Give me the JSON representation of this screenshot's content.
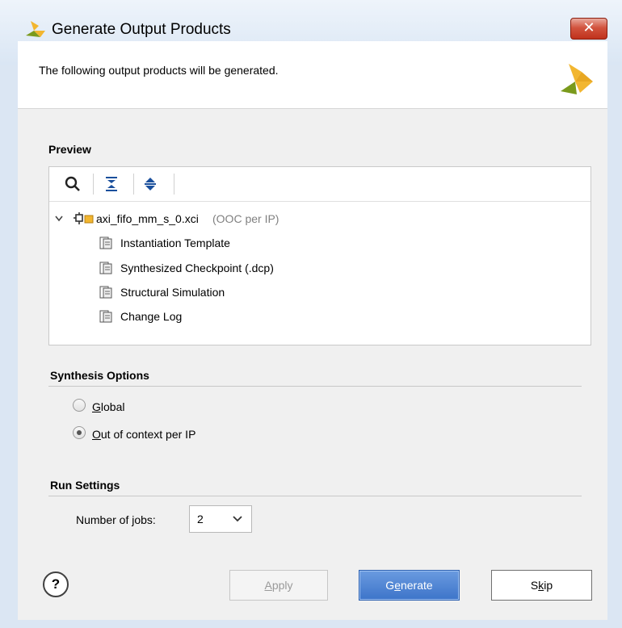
{
  "window": {
    "title": "Generate Output Products",
    "close_label": "✕"
  },
  "header": {
    "text": "The following output products will be generated."
  },
  "preview": {
    "title": "Preview",
    "toolbar": [
      "search-icon",
      "collapse-all-icon",
      "expand-all-icon"
    ],
    "tree": {
      "root": {
        "name": "axi_fifo_mm_s_0.xci",
        "note": "(OOC per IP)"
      },
      "children": [
        "Instantiation Template",
        "Synthesized Checkpoint (.dcp)",
        "Structural Simulation",
        "Change Log"
      ]
    }
  },
  "synthesis": {
    "title": "Synthesis Options",
    "options": [
      {
        "label_u": "G",
        "label_rest": "lobal",
        "selected": false
      },
      {
        "label_u": "O",
        "label_rest": "ut of context per IP",
        "selected": true
      }
    ]
  },
  "run_settings": {
    "title": "Run Settings",
    "jobs_label": "Number of jobs:",
    "jobs_value": "2"
  },
  "buttons": {
    "help": "?",
    "apply_u": "A",
    "apply_rest": "pply",
    "generate_pre": "G",
    "generate_u": "e",
    "generate_rest": "nerate",
    "skip_pre": "S",
    "skip_u": "k",
    "skip_rest": "ip"
  },
  "colors": {
    "accent": "#3d74c9",
    "logo_yellow": "#f2b630",
    "logo_green": "#7a9a1c"
  }
}
